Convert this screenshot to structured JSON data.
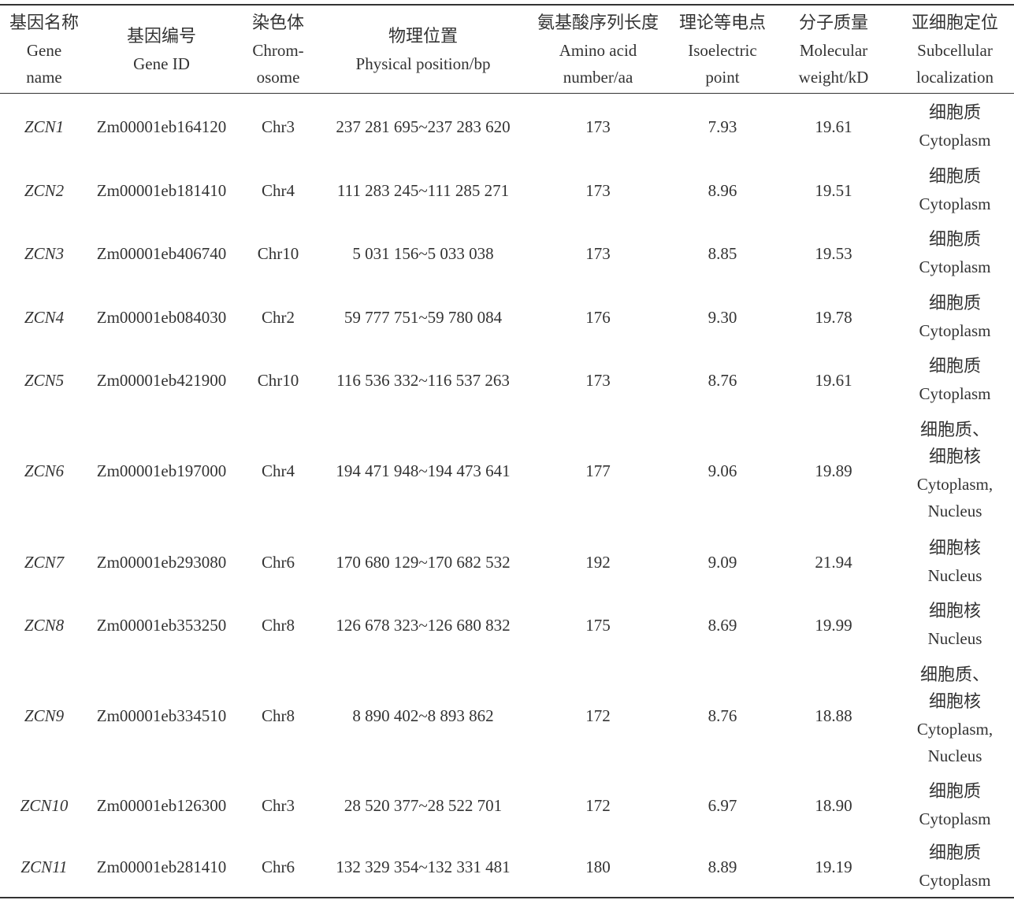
{
  "headers": [
    {
      "zh": "基因名称",
      "en1": "Gene",
      "en2": "name"
    },
    {
      "zh": "基因编号",
      "en1": "Gene ID",
      "en2": ""
    },
    {
      "zh": "染色体",
      "en1": "Chrom-",
      "en2": "osome"
    },
    {
      "zh": "物理位置",
      "en1": "Physical position/bp",
      "en2": ""
    },
    {
      "zh": "氨基酸序列长度",
      "en1": "Amino acid",
      "en2": "number/aa"
    },
    {
      "zh": "理论等电点",
      "en1": "Isoelectric",
      "en2": "point"
    },
    {
      "zh": "分子质量",
      "en1": "Molecular",
      "en2": "weight/kD"
    },
    {
      "zh": "亚细胞定位",
      "en1": "Subcellular",
      "en2": "localization"
    }
  ],
  "rows": [
    {
      "name": "ZCN1",
      "id": "Zm00001eb164120",
      "chr": "Chr3",
      "pos": "237 281 695~237 283 620",
      "aa": "173",
      "pi": "7.93",
      "mw": "19.61",
      "loc_zh": [
        "细胞质"
      ],
      "loc_en": [
        "Cytoplasm"
      ]
    },
    {
      "name": "ZCN2",
      "id": "Zm00001eb181410",
      "chr": "Chr4",
      "pos": "111 283 245~111 285 271",
      "aa": "173",
      "pi": "8.96",
      "mw": "19.51",
      "loc_zh": [
        "细胞质"
      ],
      "loc_en": [
        "Cytoplasm"
      ]
    },
    {
      "name": "ZCN3",
      "id": "Zm00001eb406740",
      "chr": "Chr10",
      "pos": "5 031 156~5 033 038",
      "aa": "173",
      "pi": "8.85",
      "mw": "19.53",
      "loc_zh": [
        "细胞质"
      ],
      "loc_en": [
        "Cytoplasm"
      ]
    },
    {
      "name": "ZCN4",
      "id": "Zm00001eb084030",
      "chr": "Chr2",
      "pos": "59 777 751~59 780 084",
      "aa": "176",
      "pi": "9.30",
      "mw": "19.78",
      "loc_zh": [
        "细胞质"
      ],
      "loc_en": [
        "Cytoplasm"
      ]
    },
    {
      "name": "ZCN5",
      "id": "Zm00001eb421900",
      "chr": "Chr10",
      "pos": "116 536 332~116 537 263",
      "aa": "173",
      "pi": "8.76",
      "mw": "19.61",
      "loc_zh": [
        "细胞质"
      ],
      "loc_en": [
        "Cytoplasm"
      ]
    },
    {
      "name": "ZCN6",
      "id": "Zm00001eb197000",
      "chr": "Chr4",
      "pos": "194 471 948~194 473 641",
      "aa": "177",
      "pi": "9.06",
      "mw": "19.89",
      "loc_zh": [
        "细胞质、",
        "细胞核"
      ],
      "loc_en": [
        "Cytoplasm,",
        "Nucleus"
      ]
    },
    {
      "name": "ZCN7",
      "id": "Zm00001eb293080",
      "chr": "Chr6",
      "pos": "170 680 129~170 682 532",
      "aa": "192",
      "pi": "9.09",
      "mw": "21.94",
      "loc_zh": [
        "细胞核"
      ],
      "loc_en": [
        "Nucleus"
      ]
    },
    {
      "name": "ZCN8",
      "id": "Zm00001eb353250",
      "chr": "Chr8",
      "pos": "126 678 323~126 680 832",
      "aa": "175",
      "pi": "8.69",
      "mw": "19.99",
      "loc_zh": [
        "细胞核"
      ],
      "loc_en": [
        "Nucleus"
      ]
    },
    {
      "name": "ZCN9",
      "id": "Zm00001eb334510",
      "chr": "Chr8",
      "pos": "8 890 402~8 893 862",
      "aa": "172",
      "pi": "8.76",
      "mw": "18.88",
      "loc_zh": [
        "细胞质、",
        "细胞核"
      ],
      "loc_en": [
        "Cytoplasm,",
        "Nucleus"
      ]
    },
    {
      "name": "ZCN10",
      "id": "Zm00001eb126300",
      "chr": "Chr3",
      "pos": "28 520 377~28 522 701",
      "aa": "172",
      "pi": "6.97",
      "mw": "18.90",
      "loc_zh": [
        "细胞质"
      ],
      "loc_en": [
        "Cytoplasm"
      ]
    },
    {
      "name": "ZCN11",
      "id": "Zm00001eb281410",
      "chr": "Chr6",
      "pos": "132 329 354~132 331 481",
      "aa": "180",
      "pi": "8.89",
      "mw": "19.19",
      "loc_zh": [
        "细胞质"
      ],
      "loc_en": [
        "Cytoplasm"
      ]
    }
  ]
}
